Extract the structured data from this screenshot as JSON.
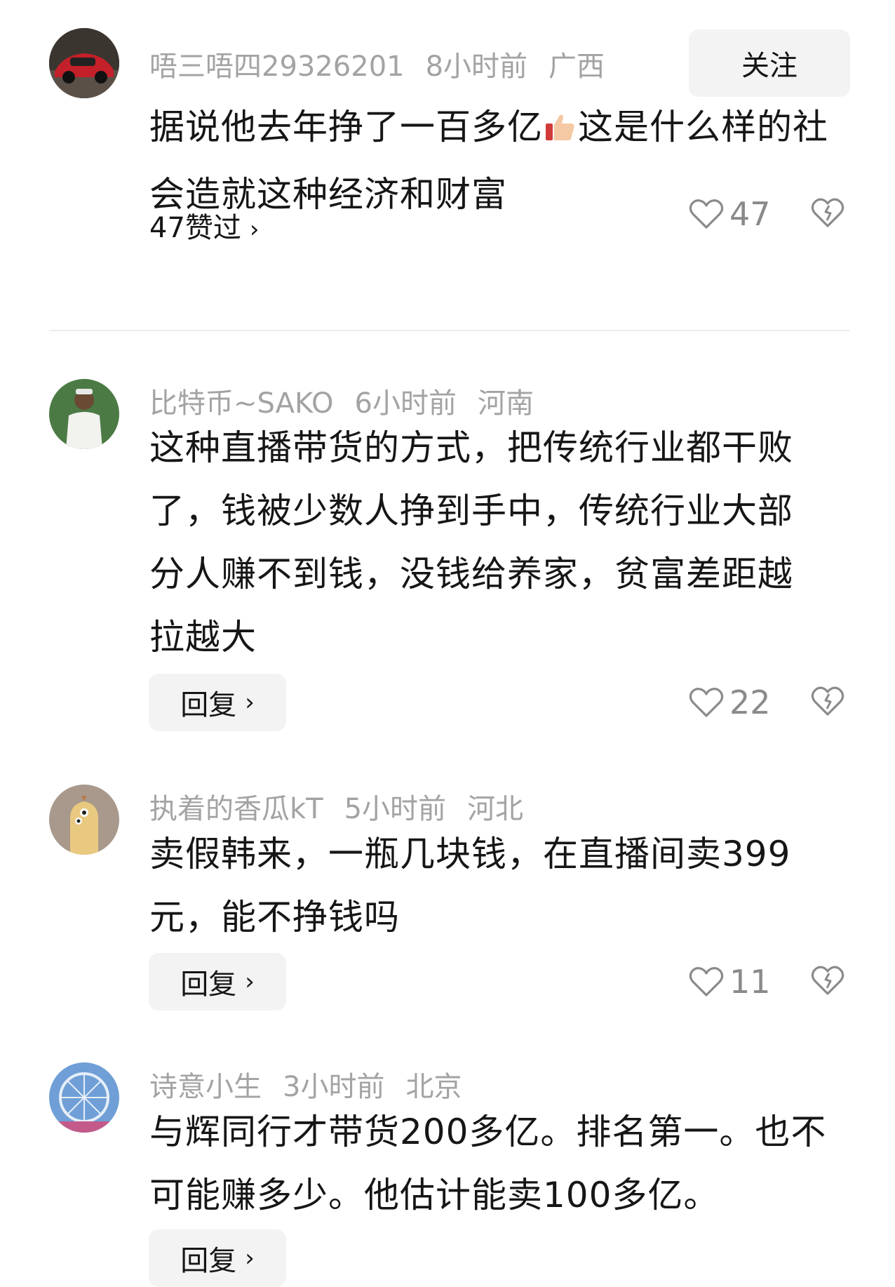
{
  "comments": [
    {
      "username": "唔三唔四29326201",
      "time": "8小时前",
      "location": "广西",
      "follow_label": "关注",
      "text_before_emoji": "据说他去年挣了一百多亿",
      "text_after_emoji": "这是什么样的社会造就这种经济和财富",
      "likes_link": "47赞过",
      "like_count": "47"
    },
    {
      "username": "比特币~SAKO",
      "time": "6小时前",
      "location": "河南",
      "text": "这种直播带货的方式，把传统行业都干败了，钱被少数人挣到手中，传统行业大部分人赚不到钱，没钱给养家，贫富差距越拉越大",
      "reply_label": "回复",
      "like_count": "22"
    },
    {
      "username": "执着的香瓜kT",
      "time": "5小时前",
      "location": "河北",
      "text": "卖假韩来，一瓶几块钱，在直播间卖399元，能不挣钱吗",
      "reply_label": "回复",
      "like_count": "11"
    },
    {
      "username": "诗意小生",
      "time": "3小时前",
      "location": "北京",
      "text": "与辉同行才带货200多亿。排名第一。也不可能赚多少。他估计能卖100多亿。",
      "reply_label": "回复"
    }
  ],
  "icons": {
    "like": "heart-outline-icon",
    "dislike": "broken-heart-icon",
    "chevron": "chevron-right-icon",
    "emoji": "thumbs-up-emoji-icon"
  }
}
